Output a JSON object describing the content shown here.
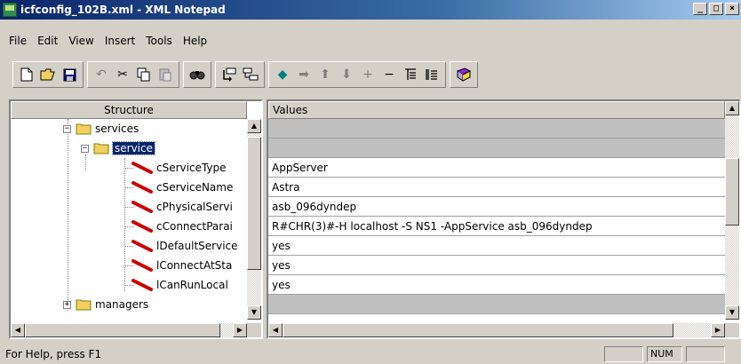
{
  "window": {
    "title": "icfconfig_102B.xml - XML Notepad",
    "minimize_glyph": "_",
    "maximize_glyph": "□",
    "close_glyph": "×"
  },
  "menu": {
    "items": [
      {
        "label": "File"
      },
      {
        "label": "Edit"
      },
      {
        "label": "View"
      },
      {
        "label": "Insert"
      },
      {
        "label": "Tools"
      },
      {
        "label": "Help"
      }
    ]
  },
  "toolbar": {
    "icons": [
      "new-file-icon",
      "open-folder-icon",
      "save-icon",
      "undo-icon",
      "cut-icon",
      "copy-icon",
      "paste-icon",
      "find-icon",
      "insert-element-icon",
      "insert-child-icon",
      "arrow-left-icon",
      "arrow-right-icon",
      "arrow-up-icon",
      "arrow-down-icon",
      "expand-plus-icon",
      "collapse-minus-icon",
      "expand-all-icon",
      "collapse-all-icon",
      "help-book-icon"
    ]
  },
  "structure": {
    "header": "Structure",
    "nodes": [
      {
        "label": "services",
        "type": "folder",
        "expander": "−"
      },
      {
        "label": "service",
        "type": "folder",
        "expander": "−",
        "selected": true
      },
      {
        "label": "cServiceType",
        "type": "attribute"
      },
      {
        "label": "cServiceName",
        "type": "attribute"
      },
      {
        "label": "cPhysicalServi",
        "type": "attribute"
      },
      {
        "label": "cConnectParai",
        "type": "attribute"
      },
      {
        "label": "lDefaultService",
        "type": "attribute"
      },
      {
        "label": "lConnectAtSta",
        "type": "attribute"
      },
      {
        "label": "lCanRunLocal",
        "type": "attribute"
      },
      {
        "label": "managers",
        "type": "folder",
        "expander": "+"
      }
    ]
  },
  "values": {
    "header": "Values",
    "rows": [
      "",
      "",
      "AppServer",
      "Astra",
      "asb_096dyndep",
      "R#CHR(3)#-H localhost -S NS1 -AppService asb_096dyndep",
      "yes",
      "yes",
      "yes",
      ""
    ]
  },
  "status": {
    "text": "For Help, press F1",
    "num": "NUM"
  },
  "colors": {
    "titlebar_start": "#0a246a",
    "titlebar_end": "#a6caf0",
    "selection": "#0a246a",
    "attribute_icon": "#cc0000",
    "folder_icon": "#f0d060"
  }
}
